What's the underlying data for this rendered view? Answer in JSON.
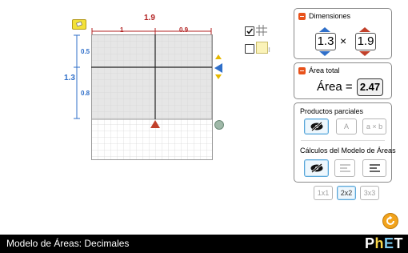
{
  "colors": {
    "width_color": "#b22222",
    "height_color": "#2f6fc9",
    "accent_orange": "#e8521b",
    "navbar": "#000000"
  },
  "diagram": {
    "total_width": "1.9",
    "width_part_1": "1",
    "width_part_2": "0.9",
    "total_height": "1.3",
    "height_part_1": "0.5",
    "height_part_2": "0.8"
  },
  "dimensions_panel": {
    "title": "Dimensiones",
    "height_value": "1.3",
    "times": "×",
    "width_value": "1.9"
  },
  "area_panel": {
    "title": "Área total",
    "label": "Área =",
    "value": "2.47"
  },
  "products_panel": {
    "title": "Productos parciales",
    "btn_a": "A",
    "btn_axb": "a × b",
    "calc_title": "Cálculos del Modelo de Áreas"
  },
  "grid_size_buttons": [
    "1x1",
    "2x2",
    "3x3"
  ],
  "navbar": {
    "title": "Modelo de Áreas: Decimales",
    "logo": "PhET"
  },
  "icons": {
    "eraser": "eraser-icon",
    "grid_toggle": "grid-icon",
    "tile_toggle": "tile-icon",
    "reset": "reset-icon",
    "eye_off": "eye-off-icon"
  }
}
